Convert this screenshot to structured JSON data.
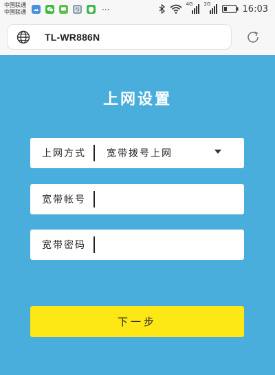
{
  "status_bar": {
    "carrier_1": "中国联通",
    "carrier_2": "中国联通",
    "app_icons": [
      "photo-app-icon",
      "wechat-icon",
      "message-app-icon",
      "gallery-app-icon",
      "shield-app-icon"
    ],
    "overflow": "···",
    "network_1": "4G",
    "network_2": "2G",
    "time": "16:03"
  },
  "browser": {
    "url": "TL-WR886N"
  },
  "page": {
    "title": "上网设置",
    "connection_type": {
      "label": "上网方式",
      "value": "宽带拨号上网"
    },
    "account": {
      "label": "宽带帐号",
      "value": ""
    },
    "password": {
      "label": "宽带密码",
      "value": ""
    },
    "next_button": "下一步"
  },
  "colors": {
    "background": "#4aaedc",
    "button": "#fde815",
    "field": "#ffffff"
  }
}
